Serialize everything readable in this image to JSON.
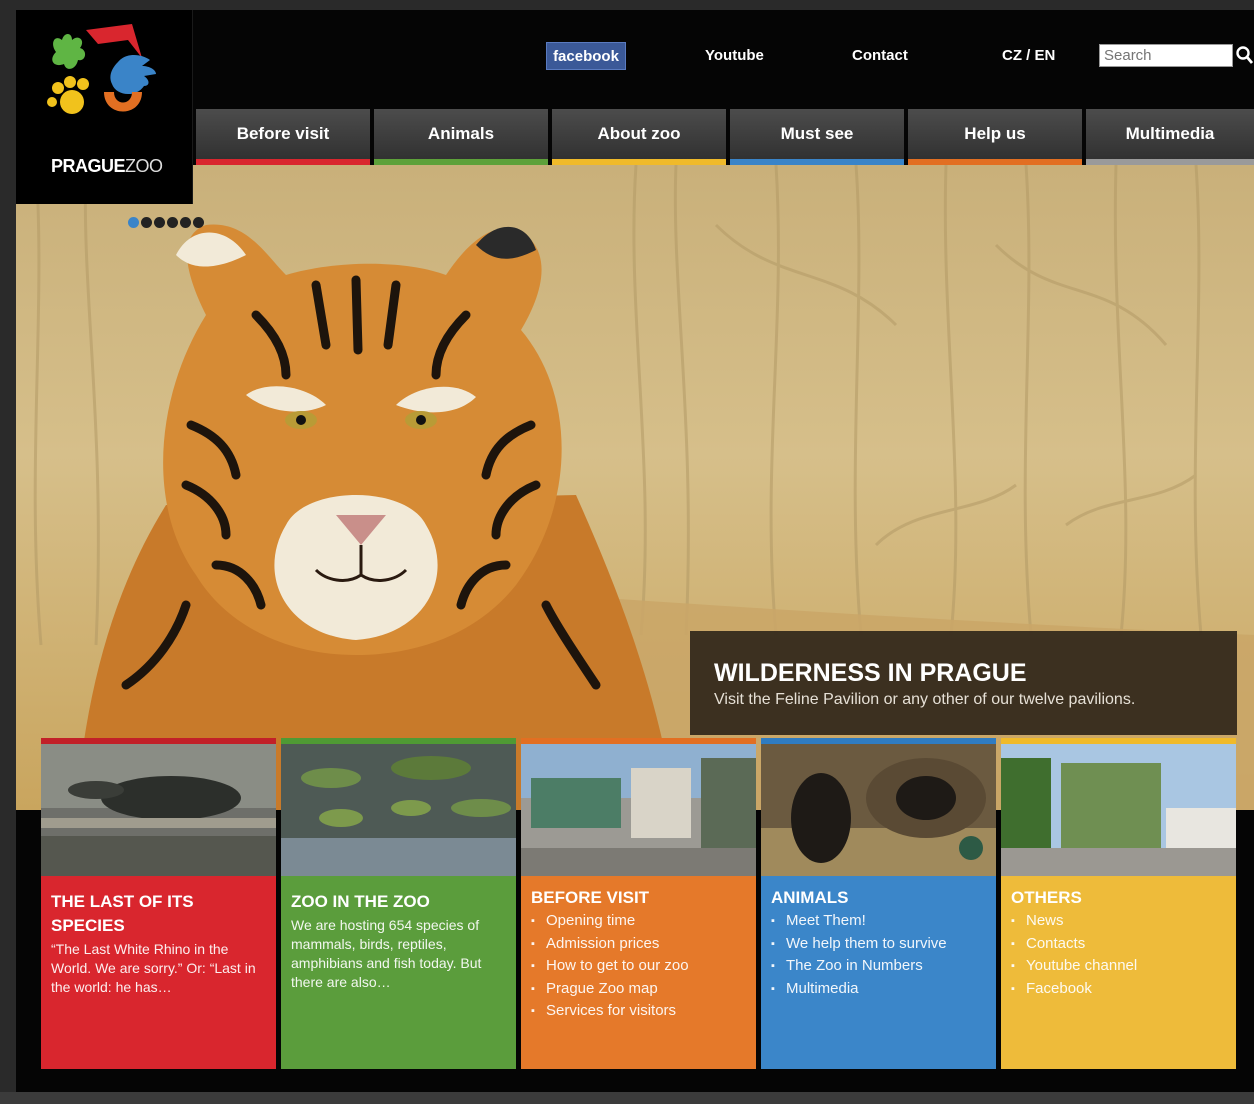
{
  "logo": {
    "text_bold": "PRAGUE",
    "text_light": "ZOO"
  },
  "toplinks": {
    "facebook": "facebook",
    "youtube": "Youtube",
    "contact": "Contact",
    "language": "CZ / EN",
    "search_placeholder": "Search"
  },
  "nav": [
    {
      "label": "Before visit",
      "color": "#d9262e"
    },
    {
      "label": "Animals",
      "color": "#5da13a"
    },
    {
      "label": "About zoo",
      "color": "#f0ba2a"
    },
    {
      "label": "Must see",
      "color": "#3a84c8"
    },
    {
      "label": "Help us",
      "color": "#e26f22"
    },
    {
      "label": "Multimedia",
      "color": "#9a9a9a"
    }
  ],
  "slider": {
    "count": 6,
    "active": 1
  },
  "hero": {
    "title": "WILDERNESS IN PRAGUE",
    "text": "Visit the Feline Pavilion or any other of our twelve pavilions."
  },
  "cards": [
    {
      "title": "THE LAST OF ITS SPECIES",
      "text": "“The Last White Rhino in the World. We are sorry.” Or: “Last in the world: he has…",
      "color": "#d9262e",
      "bar": "#c22028"
    },
    {
      "title": "ZOO IN THE ZOO",
      "text": "We are hosting 654 species of mammals, birds, reptiles, amphibians and fish today. But there are also…",
      "color": "#5b9d3c",
      "bar": "#4f9a34"
    },
    {
      "title": "BEFORE VISIT",
      "items": [
        "Opening time",
        "Admission prices",
        "How to get to our zoo",
        "Prague Zoo map",
        "Services for visitors"
      ],
      "color": "#e5792a",
      "bar": "#e26f22"
    },
    {
      "title": "ANIMALS",
      "items": [
        "Meet Them!",
        "We help them to survive",
        "The Zoo in Numbers",
        "Multimedia"
      ],
      "color": "#3b86c9",
      "bar": "#2f7cc2"
    },
    {
      "title": "OTHERS",
      "items": [
        "News",
        "Contacts",
        "Youtube channel",
        "Facebook"
      ],
      "color": "#eebb3a",
      "bar": "#f0ba2a"
    }
  ]
}
